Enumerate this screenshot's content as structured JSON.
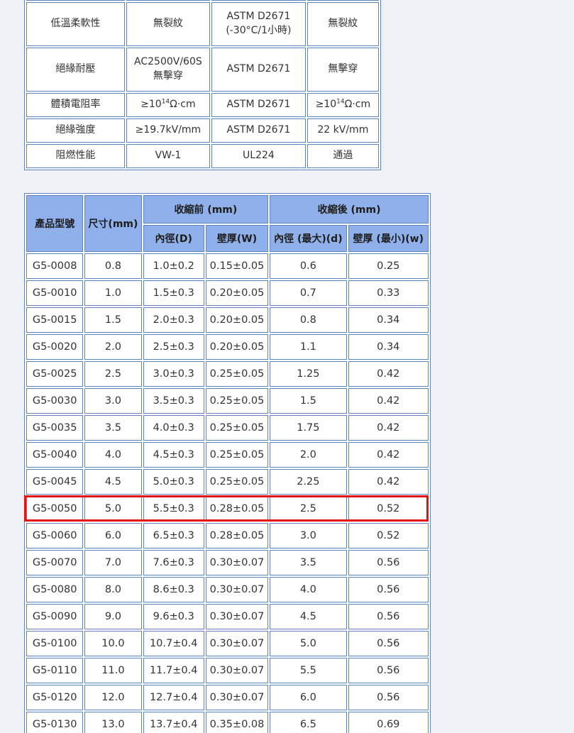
{
  "spec_table": {
    "rows": [
      {
        "property": "",
        "requirement": "",
        "method": "",
        "result": ""
      },
      {
        "property": "低溫柔軟性",
        "requirement": "無裂紋",
        "method_line1": "ASTM D2671",
        "method_line2": "(-30°C/1小時)",
        "result": "無裂紋"
      },
      {
        "property": "絕緣耐壓",
        "requirement_line1": "AC2500V/60S",
        "requirement_line2": "無擊穿",
        "method": "ASTM D2671",
        "result": "無擊穿"
      },
      {
        "property": "體積電阻率",
        "requirement_base": "≥10",
        "requirement_exp": "14",
        "requirement_unit": "Ω·cm",
        "method": "ASTM D2671",
        "result_base": "≥10",
        "result_exp": "14",
        "result_unit": "Ω·cm"
      },
      {
        "property": "絕緣強度",
        "requirement": "≥19.7kV/mm",
        "method": "ASTM D2671",
        "result": "22 kV/mm"
      },
      {
        "property": "阻燃性能",
        "requirement": "VW-1",
        "method": "UL224",
        "result": "通過"
      }
    ]
  },
  "product_table": {
    "headers": {
      "model": "產品型號",
      "size": "尺寸(mm)",
      "before": "收縮前 (mm)",
      "after": "收縮後 (mm)",
      "inner_d": "內徑(D)",
      "wall_w": "壁厚(W)",
      "inner_max": "內徑 (最大)(d)",
      "wall_min": "壁厚 (最小)(w)"
    },
    "rows": [
      [
        "G5-0008",
        "0.8",
        "1.0±0.2",
        "0.15±0.05",
        "0.6",
        "0.25"
      ],
      [
        "G5-0010",
        "1.0",
        "1.5±0.3",
        "0.20±0.05",
        "0.7",
        "0.33"
      ],
      [
        "G5-0015",
        "1.5",
        "2.0±0.3",
        "0.20±0.05",
        "0.8",
        "0.34"
      ],
      [
        "G5-0020",
        "2.0",
        "2.5±0.3",
        "0.20±0.05",
        "1.1",
        "0.34"
      ],
      [
        "G5-0025",
        "2.5",
        "3.0±0.3",
        "0.25±0.05",
        "1.25",
        "0.42"
      ],
      [
        "G5-0030",
        "3.0",
        "3.5±0.3",
        "0.25±0.05",
        "1.5",
        "0.42"
      ],
      [
        "G5-0035",
        "3.5",
        "4.0±0.3",
        "0.25±0.05",
        "1.75",
        "0.42"
      ],
      [
        "G5-0040",
        "4.0",
        "4.5±0.3",
        "0.25±0.05",
        "2.0",
        "0.42"
      ],
      [
        "G5-0045",
        "4.5",
        "5.0±0.3",
        "0.25±0.05",
        "2.25",
        "0.42"
      ],
      [
        "G5-0050",
        "5.0",
        "5.5±0.3",
        "0.28±0.05",
        "2.5",
        "0.52"
      ],
      [
        "G5-0060",
        "6.0",
        "6.5±0.3",
        "0.28±0.05",
        "3.0",
        "0.52"
      ],
      [
        "G5-0070",
        "7.0",
        "7.6±0.3",
        "0.30±0.07",
        "3.5",
        "0.56"
      ],
      [
        "G5-0080",
        "8.0",
        "8.6±0.3",
        "0.30±0.07",
        "4.0",
        "0.56"
      ],
      [
        "G5-0090",
        "9.0",
        "9.6±0.3",
        "0.30±0.07",
        "4.5",
        "0.56"
      ],
      [
        "G5-0100",
        "10.0",
        "10.7±0.4",
        "0.30±0.07",
        "5.0",
        "0.56"
      ],
      [
        "G5-0110",
        "11.0",
        "11.7±0.4",
        "0.30±0.07",
        "5.5",
        "0.56"
      ],
      [
        "G5-0120",
        "12.0",
        "12.7±0.4",
        "0.30±0.07",
        "6.0",
        "0.56"
      ],
      [
        "G5-0130",
        "13.0",
        "13.7±0.4",
        "0.35±0.08",
        "6.5",
        "0.69"
      ]
    ],
    "highlighted_row": "G5-0050"
  },
  "colors": {
    "border": "#5b84c1",
    "header_bg": "#8fb0ea",
    "highlight": "#e41212",
    "page_bg": "#eff2f7"
  }
}
